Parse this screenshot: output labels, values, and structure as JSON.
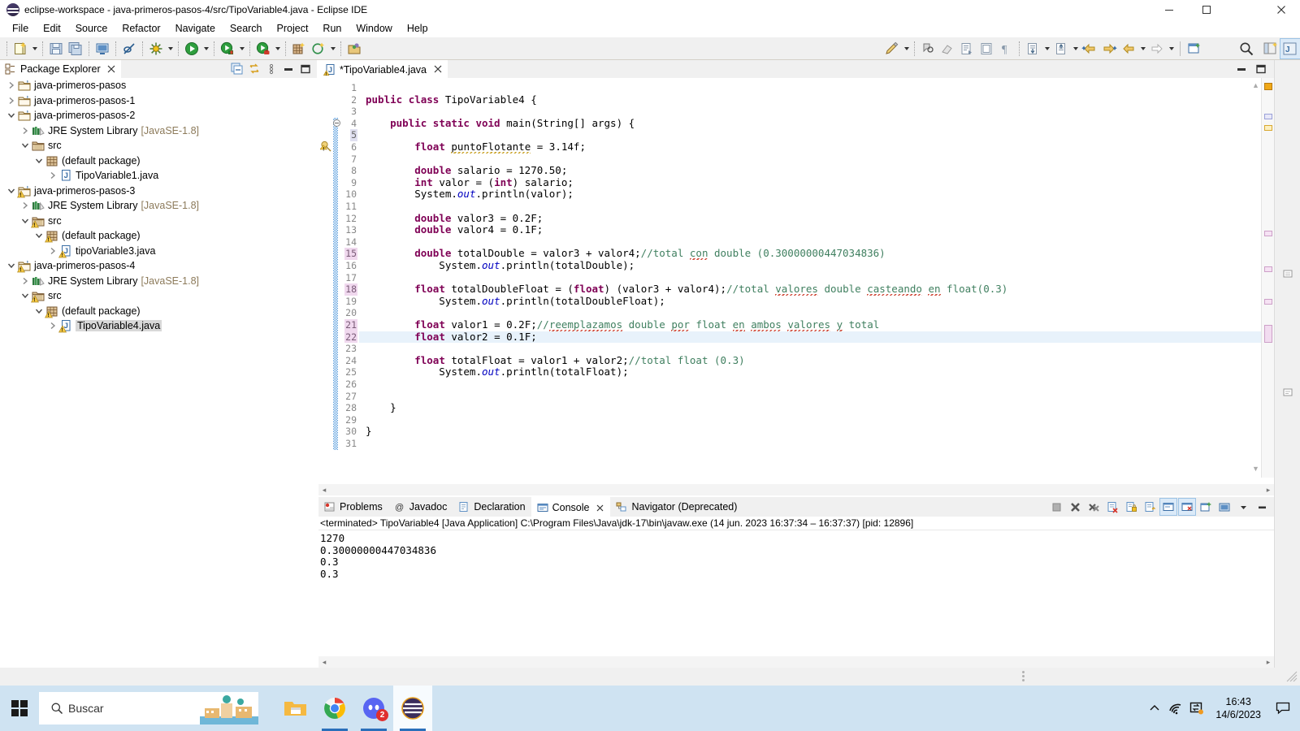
{
  "window": {
    "title": "eclipse-workspace - java-primeros-pasos-4/src/TipoVariable4.java - Eclipse IDE",
    "logo_icon": "eclipse-logo-icon",
    "minimize_label": "minimize-icon",
    "maximize_label": "maximize-icon",
    "close_label": "close-icon"
  },
  "menu": {
    "items": [
      {
        "label": "File"
      },
      {
        "label": "Edit"
      },
      {
        "label": "Source"
      },
      {
        "label": "Refactor"
      },
      {
        "label": "Navigate"
      },
      {
        "label": "Search"
      },
      {
        "label": "Project"
      },
      {
        "label": "Run"
      },
      {
        "label": "Window"
      },
      {
        "label": "Help"
      }
    ]
  },
  "toolbar": {
    "buttons": [
      {
        "name": "new-wizard-icon"
      },
      {
        "name": "save-icon"
      },
      {
        "name": "save-all-icon"
      },
      {
        "name": "print-icon"
      },
      {
        "name": "link-broken-icon"
      },
      {
        "name": "build-icon"
      },
      {
        "name": "run-icon"
      },
      {
        "name": "debug-icon"
      },
      {
        "name": "coverage-icon"
      },
      {
        "name": "new-java-package-icon"
      },
      {
        "name": "new-java-class-icon"
      },
      {
        "name": "open-type-icon"
      },
      {
        "name": "search-quick-icon"
      },
      {
        "name": "edit-pencil-icon"
      },
      {
        "name": "toggle-mark-occurrences-icon"
      },
      {
        "name": "eraser-icon"
      },
      {
        "name": "next-annotation-icon"
      },
      {
        "name": "previous-annotation-icon"
      },
      {
        "name": "pilcrow-icon"
      },
      {
        "name": "last-edit-location-icon"
      },
      {
        "name": "back-forward-icon"
      },
      {
        "name": "prev-edit-icon"
      },
      {
        "name": "next-edit-icon"
      },
      {
        "name": "back-icon"
      },
      {
        "name": "forward-icon"
      },
      {
        "name": "new-window-icon"
      }
    ],
    "right_icons": [
      {
        "name": "search-magnifier-icon"
      },
      {
        "name": "open-perspective-icon"
      },
      {
        "name": "java-perspective-icon"
      }
    ]
  },
  "package_explorer": {
    "tab_label": "Package Explorer",
    "tab_icon": "package-explorer-icon",
    "close_icon": "close-icon",
    "tools": [
      {
        "name": "collapse-all-icon"
      },
      {
        "name": "link-with-editor-icon"
      },
      {
        "name": "view-menu-icon"
      },
      {
        "name": "minimize-view-icon"
      },
      {
        "name": "maximize-view-icon"
      }
    ],
    "tree": [
      {
        "label": "java-primeros-pasos",
        "indent": 0,
        "twisty": "collapsed",
        "icon": "java-project-icon",
        "warn": false,
        "selected": false,
        "suffix": ""
      },
      {
        "label": "java-primeros-pasos-1",
        "indent": 0,
        "twisty": "collapsed",
        "icon": "java-project-icon",
        "warn": false,
        "selected": false,
        "suffix": ""
      },
      {
        "label": "java-primeros-pasos-2",
        "indent": 0,
        "twisty": "expanded",
        "icon": "java-project-icon",
        "warn": false,
        "selected": false,
        "suffix": ""
      },
      {
        "label": "JRE System Library",
        "indent": 1,
        "twisty": "collapsed",
        "icon": "jre-library-icon",
        "warn": false,
        "selected": false,
        "suffix": "[JavaSE-1.8]"
      },
      {
        "label": "src",
        "indent": 1,
        "twisty": "expanded",
        "icon": "source-folder-icon",
        "warn": false,
        "selected": false,
        "suffix": ""
      },
      {
        "label": "(default package)",
        "indent": 2,
        "twisty": "expanded",
        "icon": "package-icon",
        "warn": false,
        "selected": false,
        "suffix": ""
      },
      {
        "label": "TipoVariable1.java",
        "indent": 3,
        "twisty": "collapsed",
        "icon": "java-file-icon",
        "warn": false,
        "selected": false,
        "suffix": ""
      },
      {
        "label": "java-primeros-pasos-3",
        "indent": 0,
        "twisty": "expanded",
        "icon": "java-project-icon",
        "warn": true,
        "selected": false,
        "suffix": ""
      },
      {
        "label": "JRE System Library",
        "indent": 1,
        "twisty": "collapsed",
        "icon": "jre-library-icon",
        "warn": false,
        "selected": false,
        "suffix": "[JavaSE-1.8]"
      },
      {
        "label": "src",
        "indent": 1,
        "twisty": "expanded",
        "icon": "source-folder-icon",
        "warn": true,
        "selected": false,
        "suffix": ""
      },
      {
        "label": "(default package)",
        "indent": 2,
        "twisty": "expanded",
        "icon": "package-icon",
        "warn": true,
        "selected": false,
        "suffix": ""
      },
      {
        "label": "tipoVariable3.java",
        "indent": 3,
        "twisty": "collapsed",
        "icon": "java-file-icon",
        "warn": true,
        "selected": false,
        "suffix": ""
      },
      {
        "label": "java-primeros-pasos-4",
        "indent": 0,
        "twisty": "expanded",
        "icon": "java-project-icon",
        "warn": true,
        "selected": false,
        "suffix": ""
      },
      {
        "label": "JRE System Library",
        "indent": 1,
        "twisty": "collapsed",
        "icon": "jre-library-icon",
        "warn": false,
        "selected": false,
        "suffix": "[JavaSE-1.8]"
      },
      {
        "label": "src",
        "indent": 1,
        "twisty": "expanded",
        "icon": "source-folder-icon",
        "warn": true,
        "selected": false,
        "suffix": ""
      },
      {
        "label": "(default package)",
        "indent": 2,
        "twisty": "expanded",
        "icon": "package-icon",
        "warn": true,
        "selected": false,
        "suffix": ""
      },
      {
        "label": "TipoVariable4.java",
        "indent": 3,
        "twisty": "collapsed",
        "icon": "java-file-icon",
        "warn": true,
        "selected": true,
        "suffix": ""
      }
    ]
  },
  "editor": {
    "tab_label": "*TipoVariable4.java",
    "tab_icon": "java-file-warning-icon",
    "close_icon": "close-icon",
    "minimize_icon": "minimize-view-icon",
    "maximize_icon": "maximize-view-icon",
    "current_line": 22,
    "warning_line": 6,
    "fold_line": 4,
    "marked_line_numbers": [
      5,
      15,
      18,
      21,
      22
    ],
    "lines": [
      {
        "n": 1,
        "text": ""
      },
      {
        "n": 2,
        "text": "public class TipoVariable4 {"
      },
      {
        "n": 3,
        "text": ""
      },
      {
        "n": 4,
        "text": "    public static void main(String[] args) {"
      },
      {
        "n": 5,
        "text": ""
      },
      {
        "n": 6,
        "text": "        float puntoFlotante = 3.14f;"
      },
      {
        "n": 7,
        "text": ""
      },
      {
        "n": 8,
        "text": "        double salario = 1270.50;"
      },
      {
        "n": 9,
        "text": "        int valor = (int) salario;"
      },
      {
        "n": 10,
        "text": "        System.out.println(valor);"
      },
      {
        "n": 11,
        "text": ""
      },
      {
        "n": 12,
        "text": "        double valor3 = 0.2F;"
      },
      {
        "n": 13,
        "text": "        double valor4 = 0.1F;"
      },
      {
        "n": 14,
        "text": ""
      },
      {
        "n": 15,
        "text": "        double totalDouble = valor3 + valor4;//total con double (0.30000000447034836)"
      },
      {
        "n": 16,
        "text": "            System.out.println(totalDouble);"
      },
      {
        "n": 17,
        "text": ""
      },
      {
        "n": 18,
        "text": "        float totalDoubleFloat = (float) (valor3 + valor4);//total valores double casteando en float(0.3)"
      },
      {
        "n": 19,
        "text": "            System.out.println(totalDoubleFloat);"
      },
      {
        "n": 20,
        "text": ""
      },
      {
        "n": 21,
        "text": "        float valor1 = 0.2F;//reemplazamos double por float en ambos valores y total"
      },
      {
        "n": 22,
        "text": "        float valor2 = 0.1F;"
      },
      {
        "n": 23,
        "text": ""
      },
      {
        "n": 24,
        "text": "        float totalFloat = valor1 + valor2;//total float (0.3)"
      },
      {
        "n": 25,
        "text": "            System.out.println(totalFloat);"
      },
      {
        "n": 26,
        "text": ""
      },
      {
        "n": 27,
        "text": ""
      },
      {
        "n": 28,
        "text": "    }"
      },
      {
        "n": 29,
        "text": ""
      },
      {
        "n": 30,
        "text": "}"
      },
      {
        "n": 31,
        "text": ""
      }
    ]
  },
  "console": {
    "tabs": [
      {
        "label": "Problems",
        "icon": "problems-icon",
        "active": false
      },
      {
        "label": "Javadoc",
        "icon": "javadoc-icon",
        "active": false
      },
      {
        "label": "Declaration",
        "icon": "declaration-icon",
        "active": false
      },
      {
        "label": "Console",
        "icon": "console-icon",
        "active": true
      },
      {
        "label": "Navigator (Deprecated)",
        "icon": "navigator-icon",
        "active": false
      }
    ],
    "close_icon": "close-icon",
    "tools": [
      {
        "name": "terminate-icon"
      },
      {
        "name": "remove-launch-icon"
      },
      {
        "name": "remove-all-terminated-icon"
      },
      {
        "name": "clear-console-icon"
      },
      {
        "name": "scroll-lock-icon"
      },
      {
        "name": "word-wrap-icon"
      },
      {
        "name": "pin-console-icon"
      },
      {
        "name": "display-selected-console-icon"
      },
      {
        "name": "new-console-view-icon"
      },
      {
        "name": "open-console-icon"
      },
      {
        "name": "view-menu-icon"
      },
      {
        "name": "minimize-view-icon"
      }
    ],
    "header": "<terminated> TipoVariable4 [Java Application] C:\\Program Files\\Java\\jdk-17\\bin\\javaw.exe  (14 jun. 2023 16:37:34 – 16:37:37) [pid: 12896]",
    "output": [
      "1270",
      "0.30000000447034836",
      "0.3",
      "0.3"
    ]
  },
  "right_strip": {
    "buttons": [
      {
        "name": "restore-view-icon"
      },
      {
        "name": "outline-view-icon"
      },
      {
        "name": "task-list-icon"
      }
    ]
  },
  "taskbar": {
    "start_icon": "windows-start-icon",
    "search": {
      "placeholder": "Buscar",
      "icon": "search-icon"
    },
    "apps": [
      {
        "name": "file-explorer-icon",
        "running": false,
        "badge": ""
      },
      {
        "name": "chrome-icon",
        "running": true,
        "badge": ""
      },
      {
        "name": "discord-icon",
        "running": true,
        "badge": "2"
      },
      {
        "name": "eclipse-icon",
        "running": true,
        "active": true,
        "badge": ""
      }
    ],
    "tray": [
      {
        "name": "show-hidden-icons-icon"
      },
      {
        "name": "wifi-icon"
      },
      {
        "name": "display-switch-icon"
      }
    ],
    "clock": {
      "time": "16:43",
      "date": "14/6/2023"
    },
    "notifications_icon": "notification-center-icon"
  },
  "colors": {
    "keyword": "#7f0055",
    "comment": "#3f7f5f",
    "static_field": "#0000c0",
    "current_line": "#e8f2fb",
    "selection": "#d8d8d8",
    "taskbar": "#cfe3f2",
    "toolbar": "#f0f0f0"
  }
}
